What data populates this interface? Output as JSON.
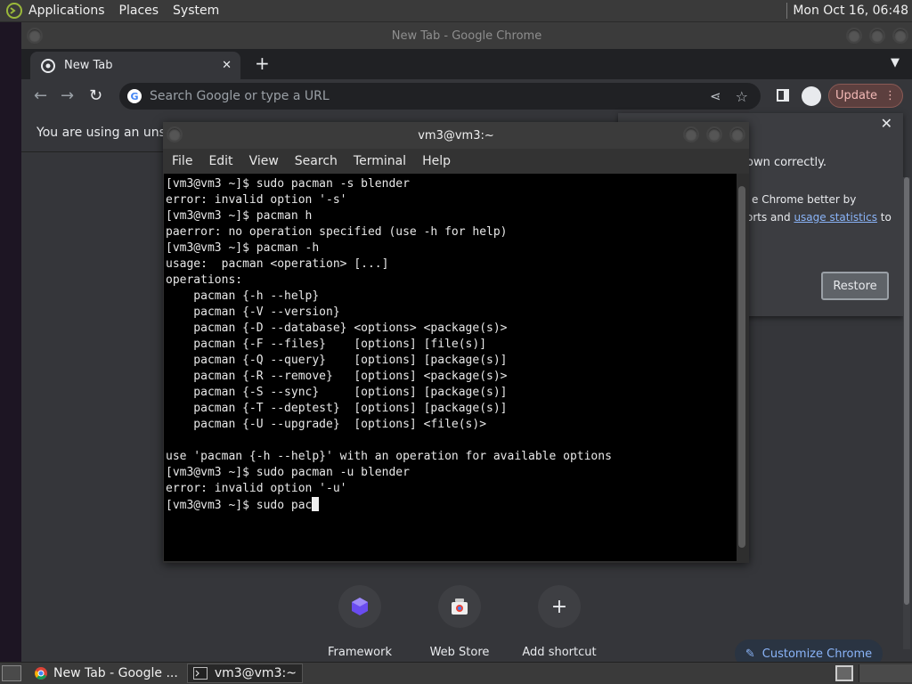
{
  "top_panel": {
    "menus": [
      "Applications",
      "Places",
      "System"
    ],
    "clock": "Mon Oct 16, 06:48"
  },
  "chrome": {
    "window_title": "New Tab - Google Chrome",
    "tab_label": "New Tab",
    "omnibox_placeholder": "Search Google or type a URL",
    "update_label": "Update",
    "infobar_message": "You are using an unsup",
    "dialog": {
      "line1": "own correctly.",
      "line2": "e Chrome better by",
      "line3_prefix": "orts and ",
      "line3_link": "usage statistics",
      "line3_suffix": " to",
      "restore_label": "Restore"
    },
    "shortcuts": [
      {
        "label": "Framework",
        "icon": "framework-icon"
      },
      {
        "label": "Web Store",
        "icon": "webstore-icon"
      },
      {
        "label": "Add shortcut",
        "icon": "plus-icon"
      }
    ],
    "customize_label": "Customize Chrome"
  },
  "terminal": {
    "title": "vm3@vm3:~",
    "menus": [
      "File",
      "Edit",
      "View",
      "Search",
      "Terminal",
      "Help"
    ],
    "lines": [
      "[vm3@vm3 ~]$ sudo pacman -s blender",
      "error: invalid option '-s'",
      "[vm3@vm3 ~]$ pacman h",
      "paerror: no operation specified (use -h for help)",
      "[vm3@vm3 ~]$ pacman -h",
      "usage:  pacman <operation> [...]",
      "operations:",
      "    pacman {-h --help}",
      "    pacman {-V --version}",
      "    pacman {-D --database} <options> <package(s)>",
      "    pacman {-F --files}    [options] [file(s)]",
      "    pacman {-Q --query}    [options] [package(s)]",
      "    pacman {-R --remove}   [options] <package(s)>",
      "    pacman {-S --sync}     [options] [package(s)]",
      "    pacman {-T --deptest}  [options] [package(s)]",
      "    pacman {-U --upgrade}  [options] <file(s)>",
      "",
      "use 'pacman {-h --help}' with an operation for available options",
      "[vm3@vm3 ~]$ sudo pacman -u blender",
      "error: invalid option '-u'"
    ],
    "current_input": "[vm3@vm3 ~]$ sudo pac"
  },
  "taskbar": {
    "tasks": [
      {
        "label": "New Tab - Google ...",
        "icon": "chrome-icon"
      },
      {
        "label": "vm3@vm3:~",
        "icon": "terminal-icon"
      }
    ]
  },
  "colors": {
    "accent_link": "#8ab4f8",
    "update_text": "#f2b8b5",
    "terminal_bg": "#000000"
  }
}
